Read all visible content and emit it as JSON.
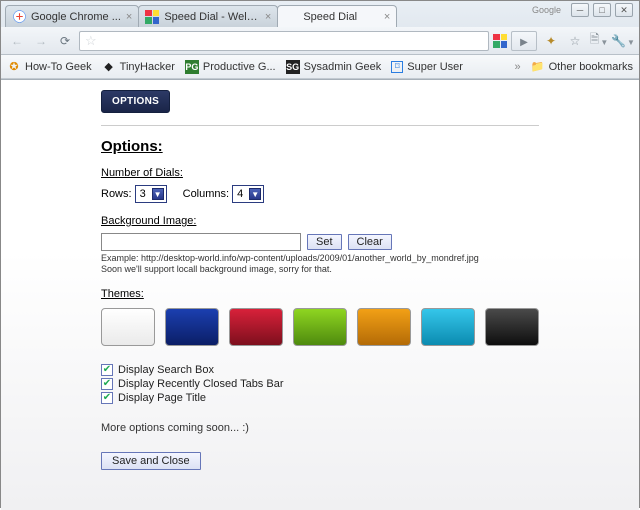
{
  "browser": {
    "tabs": [
      {
        "title": "Google Chrome ...",
        "favicon": "google"
      },
      {
        "title": "Speed Dial - Welco...",
        "favicon": "grid"
      },
      {
        "title": "Speed Dial",
        "favicon": "none",
        "active": true
      }
    ],
    "toolbar": {
      "back": "←",
      "forward": "→",
      "reload": "⟳",
      "star": "☆",
      "page_menu": "🗎",
      "wrench_menu": "🔧",
      "play": "▶"
    },
    "bookmarks": [
      {
        "label": "How-To Geek",
        "icon": "htg"
      },
      {
        "label": "TinyHacker",
        "icon": "th"
      },
      {
        "label": "Productive G...",
        "icon": "pg"
      },
      {
        "label": "Sysadmin Geek",
        "icon": "sg"
      },
      {
        "label": "Super User",
        "icon": "su"
      }
    ],
    "bookmarks_overflow": "»",
    "other_bookmarks": "Other bookmarks"
  },
  "page": {
    "options_button": "OPTIONS",
    "heading": "Options:",
    "dials_label": "Number of Dials:",
    "rows_label": "Rows:",
    "rows_value": "3",
    "cols_label": "Columns:",
    "cols_value": "4",
    "bg_label": "Background Image:",
    "bg_value": "",
    "set_label": "Set",
    "clear_label": "Clear",
    "example_text": "Example: http://desktop-world.info/wp-content/uploads/2009/01/another_world_by_mondref.jpg\nSoon we'll support locall background image, sorry for that.",
    "themes_label": "Themes:",
    "themes": [
      "white",
      "blue",
      "red",
      "green",
      "orange",
      "cyan",
      "black"
    ],
    "checks": [
      "Display Search Box",
      "Display Recently Closed Tabs Bar",
      "Display Page Title"
    ],
    "coming": "More options coming soon... :)",
    "save_label": "Save and Close"
  }
}
